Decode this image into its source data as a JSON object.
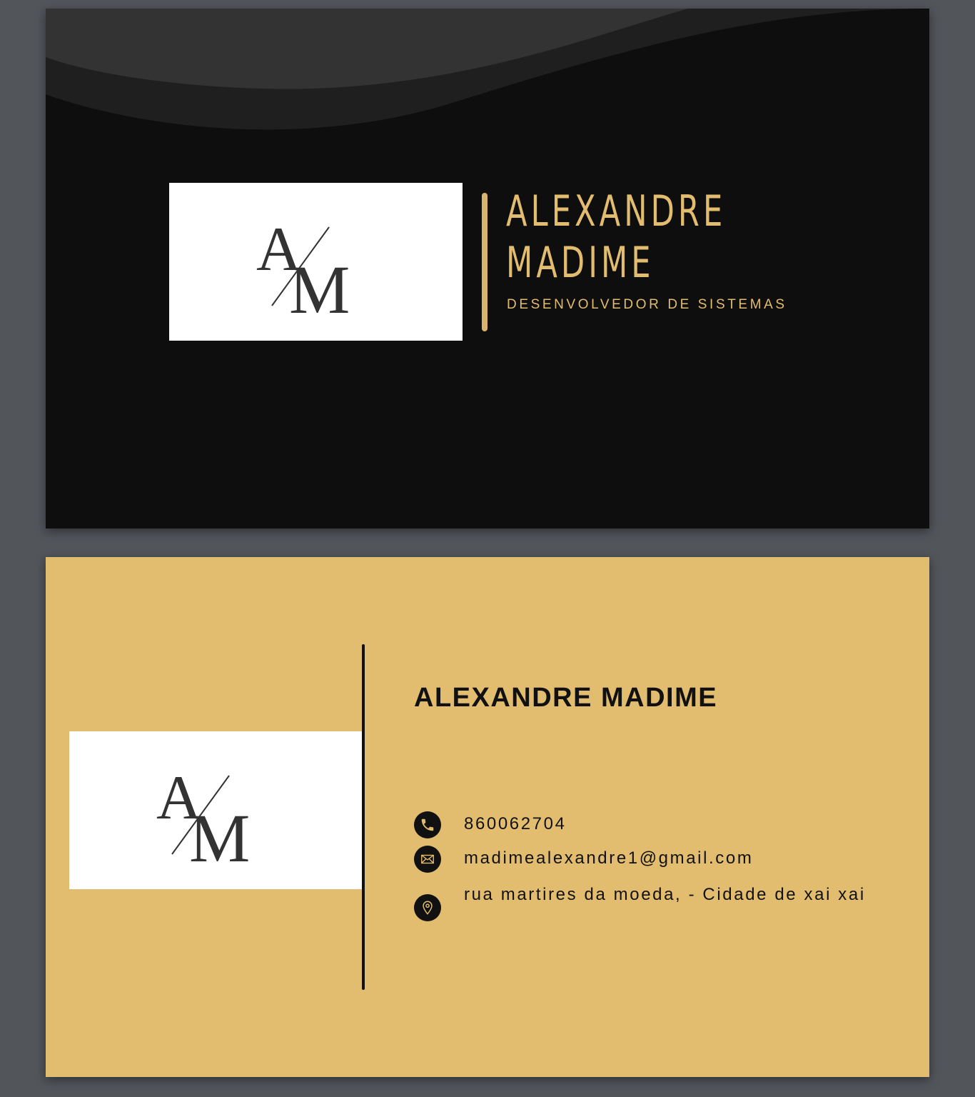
{
  "front": {
    "logo": {
      "letters": [
        "A",
        "M"
      ]
    },
    "name_line1": "ALEXANDRE",
    "name_line2": "MADIME",
    "title": "DESENVOLVEDOR DE SISTEMAS",
    "colors": {
      "background": "#0e0e0e",
      "accent": "#e3bd6f"
    }
  },
  "back": {
    "logo": {
      "letters": [
        "A",
        "M"
      ]
    },
    "name": "ALEXANDRE MADIME",
    "contacts": [
      {
        "icon": "phone-icon",
        "text": "860062704"
      },
      {
        "icon": "email-icon",
        "text": "madimealexandre1@gmail.com"
      },
      {
        "icon": "location-pin-icon",
        "text": "rua martires da moeda,  - Cidade de xai xai"
      }
    ],
    "colors": {
      "background": "#e3bd6f",
      "text": "#111111"
    }
  }
}
